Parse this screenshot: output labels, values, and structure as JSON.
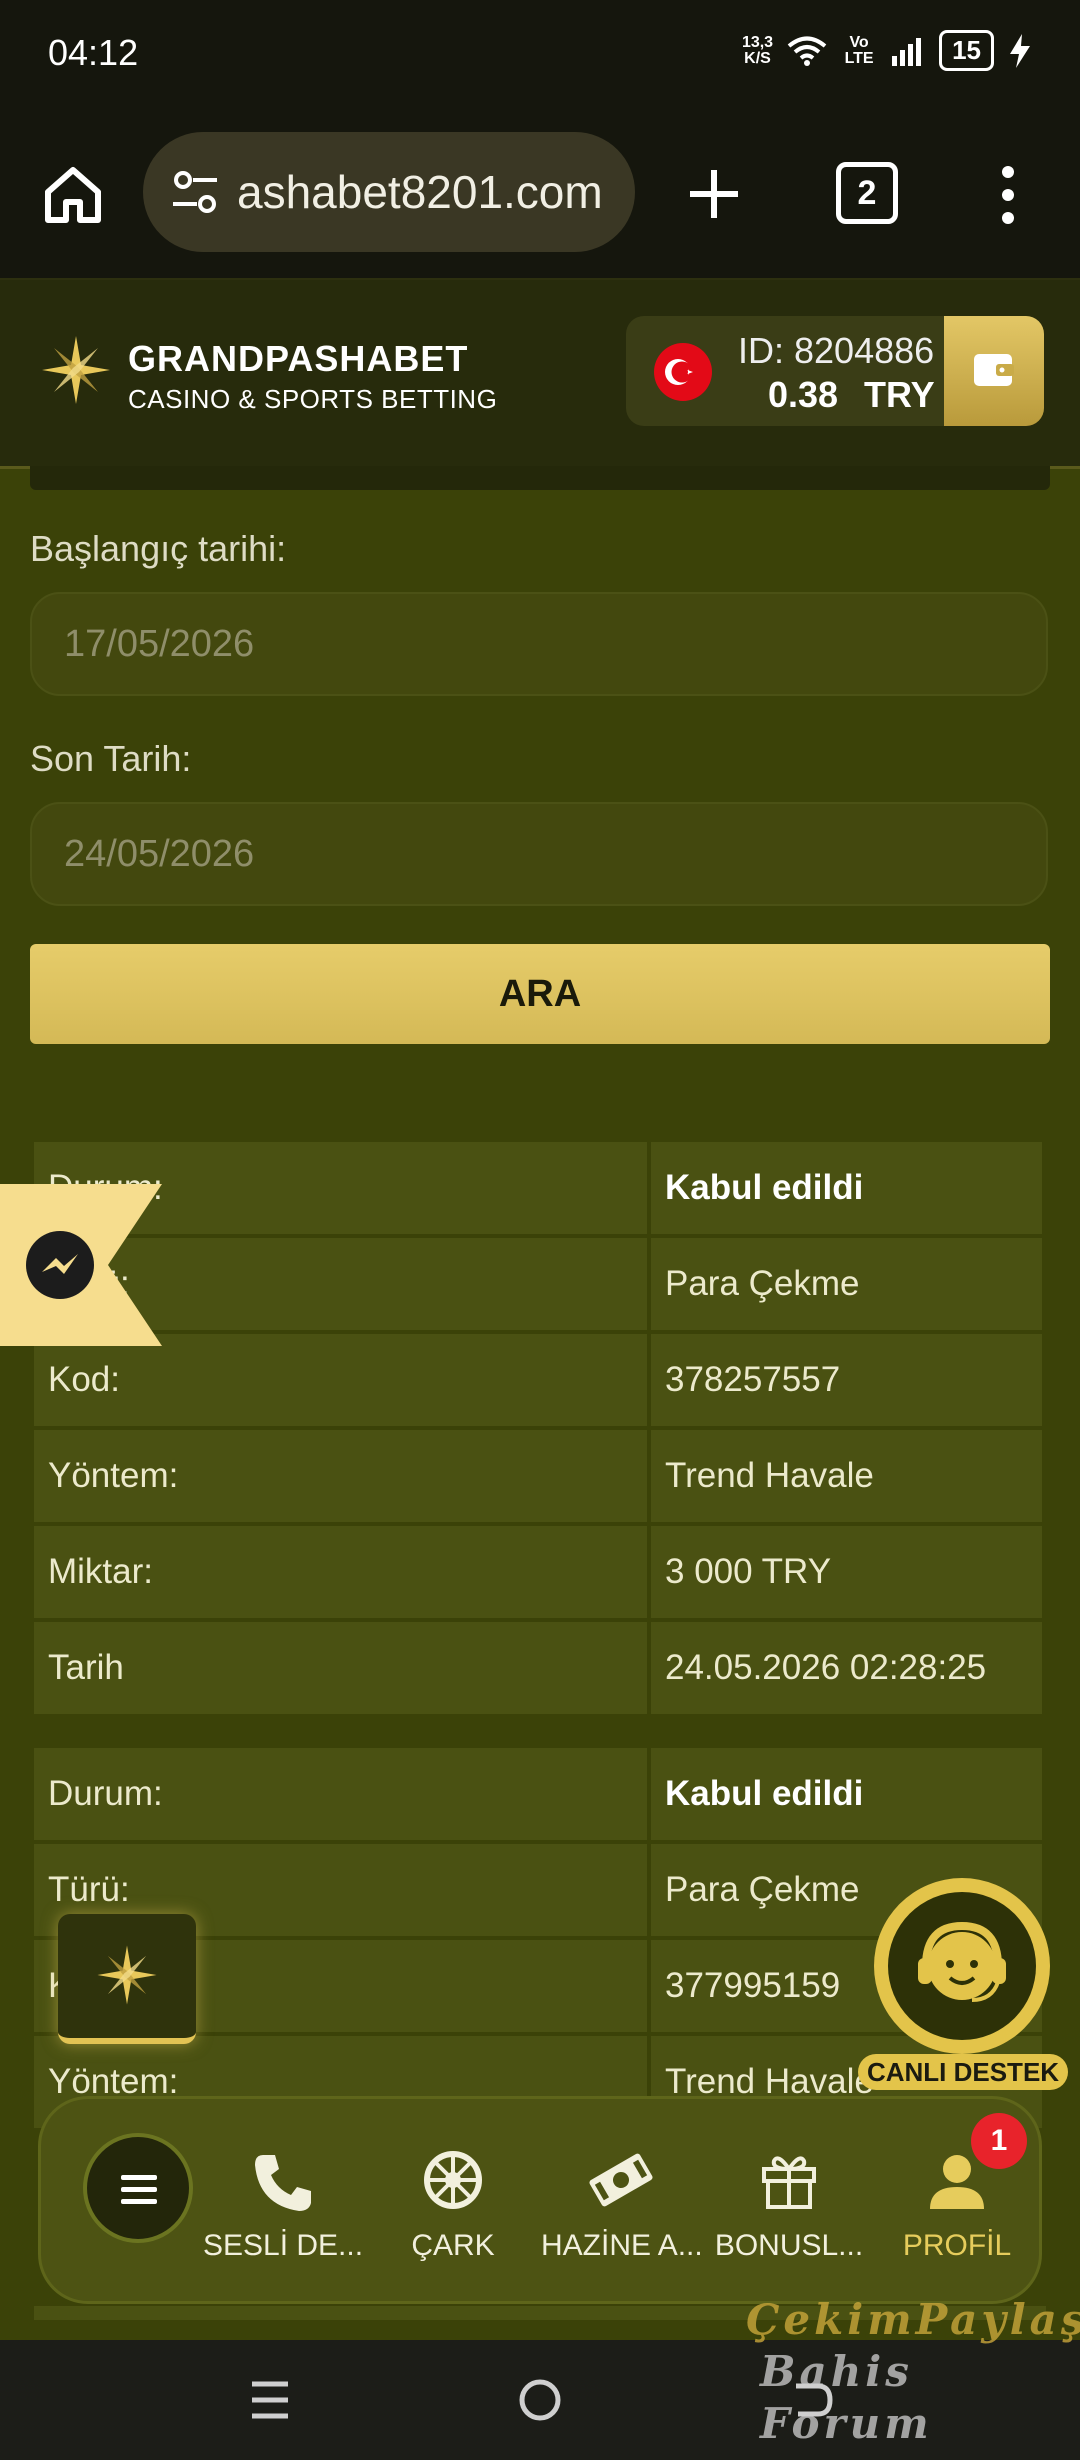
{
  "status_bar": {
    "time": "04:12",
    "net_speed": "13,3",
    "net_unit": "K/S",
    "volte": "Vo LTE",
    "battery": "15"
  },
  "browser": {
    "url": "ashabet8201.com",
    "tab_count": "2"
  },
  "site_header": {
    "brand_name": "GRANDPASHABET",
    "brand_sub": "CASINO & SPORTS BETTING",
    "account_id": "ID: 8204886",
    "balance": "0.38",
    "currency": "TRY"
  },
  "filters": {
    "start_label": "Başlangıç tarihi:",
    "start_value": "17/05/2026",
    "end_label": "Son Tarih:",
    "end_value": "24/05/2026",
    "search_button": "ARA"
  },
  "transactions": [
    {
      "rows": [
        {
          "key": "Durum:",
          "value": "Kabul edildi",
          "bold": true
        },
        {
          "key": "Türü:",
          "value": "Para Çekme"
        },
        {
          "key": "Kod:",
          "value": "378257557"
        },
        {
          "key": "Yöntem:",
          "value": "Trend Havale"
        },
        {
          "key": "Miktar:",
          "value": "3 000 TRY"
        },
        {
          "key": "Tarih",
          "value": "24.05.2026 02:28:25"
        }
      ]
    },
    {
      "rows": [
        {
          "key": "Durum:",
          "value": "Kabul edildi",
          "bold": true
        },
        {
          "key": "Türü:",
          "value": "Para Çekme"
        },
        {
          "key": "Kod:",
          "value": "377995159"
        },
        {
          "key": "Yöntem:",
          "value": "Trend Havale"
        }
      ]
    }
  ],
  "support": {
    "label": "CANLI DESTEK"
  },
  "bottom_nav": {
    "items": [
      {
        "label": "SESLİ DE...",
        "icon": "phone-icon"
      },
      {
        "label": "ÇARK",
        "icon": "wheel-icon"
      },
      {
        "label": "HAZİNE A...",
        "icon": "money-icon"
      },
      {
        "label": "BONUSL...",
        "icon": "gift-icon"
      },
      {
        "label": "PROFİL",
        "icon": "user-icon"
      }
    ],
    "profile_badge": "1"
  },
  "watermark": {
    "line1": "ÇekimPaylaş",
    "line2": "Bahis Forum"
  },
  "colors": {
    "accent_gold": "#e3c44a",
    "page_bg": "#3b4208",
    "cell_bg": "#4a5112",
    "badge_red": "#e8232b"
  }
}
